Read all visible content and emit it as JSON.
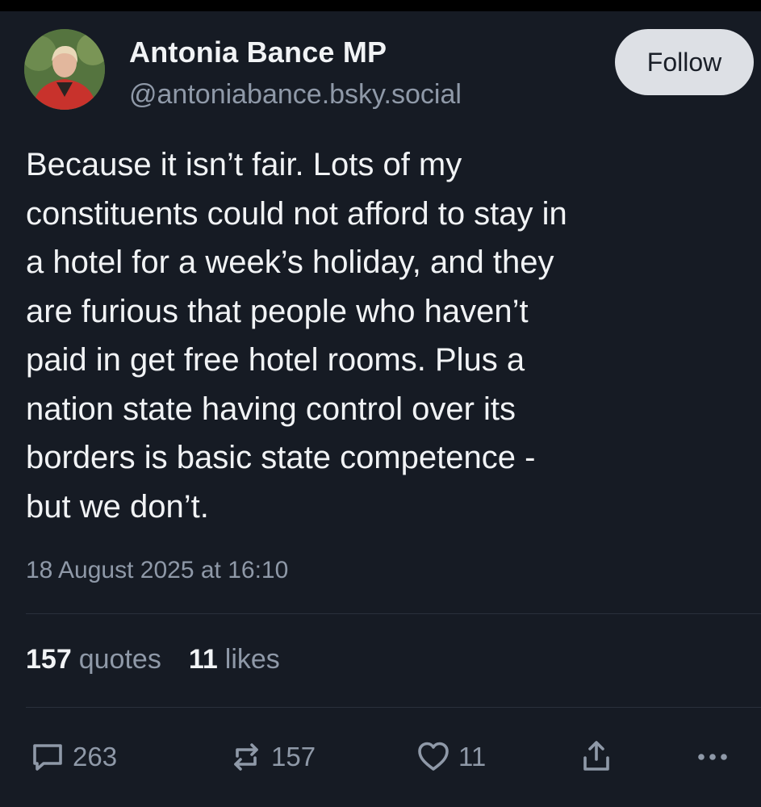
{
  "post": {
    "author_name": "Antonia Bance MP",
    "author_handle": "@antoniabance.bsky.social",
    "follow_label": "Follow",
    "text": "Because it isn’t fair. Lots of my\nconstituents could not afford to stay in\na hotel for a week’s holiday, and they\nare furious that people who haven’t\npaid in get free hotel rooms. Plus a\nnation state having control over its\nborders is basic state competence -\nbut we don’t.",
    "timestamp": "18 August 2025 at 16:10"
  },
  "stats": {
    "quotes_count": "157",
    "quotes_label": "quotes",
    "likes_count": "11",
    "likes_label": "likes"
  },
  "actions": {
    "reply_count": "263",
    "repost_count": "157",
    "like_count": "11",
    "reply_icon": "reply-bubble-icon",
    "repost_icon": "repost-arrows-icon",
    "like_icon": "heart-icon",
    "share_icon": "share-icon",
    "more_icon": "more-dots-icon"
  },
  "colors": {
    "background": "#161b24",
    "text_primary": "#f1f3f5",
    "text_secondary": "#8f99a8",
    "follow_button_bg": "#dde0e5"
  }
}
